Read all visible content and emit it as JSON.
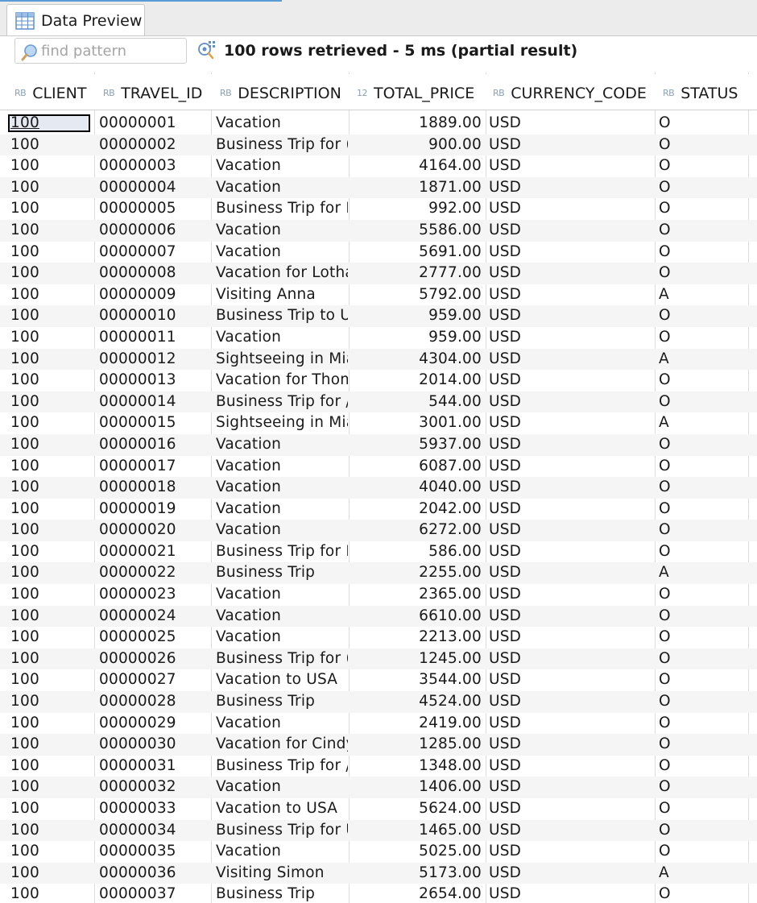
{
  "tab": {
    "label": "Data Preview"
  },
  "toolbar": {
    "search_placeholder": "find pattern",
    "status": "100 rows retrieved - 5 ms (partial result)"
  },
  "columns": [
    {
      "type": "RB",
      "name": "CLIENT"
    },
    {
      "type": "RB",
      "name": "TRAVEL_ID"
    },
    {
      "type": "RB",
      "name": "DESCRIPTION"
    },
    {
      "type": "12",
      "name": "TOTAL_PRICE"
    },
    {
      "type": "RB",
      "name": "CURRENCY_CODE"
    },
    {
      "type": "RB",
      "name": "STATUS"
    }
  ],
  "rows": [
    [
      "100",
      "00000001",
      "Vacation",
      "1889.00",
      "USD",
      "O"
    ],
    [
      "100",
      "00000002",
      "Business Trip for (",
      "900.00",
      "USD",
      "O"
    ],
    [
      "100",
      "00000003",
      "Vacation",
      "4164.00",
      "USD",
      "O"
    ],
    [
      "100",
      "00000004",
      "Vacation",
      "1871.00",
      "USD",
      "O"
    ],
    [
      "100",
      "00000005",
      "Business Trip for I",
      "992.00",
      "USD",
      "O"
    ],
    [
      "100",
      "00000006",
      "Vacation",
      "5586.00",
      "USD",
      "O"
    ],
    [
      "100",
      "00000007",
      "Vacation",
      "5691.00",
      "USD",
      "O"
    ],
    [
      "100",
      "00000008",
      "Vacation for Lotha",
      "2777.00",
      "USD",
      "O"
    ],
    [
      "100",
      "00000009",
      "Visiting Anna",
      "5792.00",
      "USD",
      "A"
    ],
    [
      "100",
      "00000010",
      "Business Trip to U",
      "959.00",
      "USD",
      "O"
    ],
    [
      "100",
      "00000011",
      "Vacation",
      "959.00",
      "USD",
      "O"
    ],
    [
      "100",
      "00000012",
      "Sightseeing in Mia",
      "4304.00",
      "USD",
      "A"
    ],
    [
      "100",
      "00000013",
      "Vacation for Thom",
      "2014.00",
      "USD",
      "O"
    ],
    [
      "100",
      "00000014",
      "Business Trip for /",
      "544.00",
      "USD",
      "O"
    ],
    [
      "100",
      "00000015",
      "Sightseeing in Mia",
      "3001.00",
      "USD",
      "A"
    ],
    [
      "100",
      "00000016",
      "Vacation",
      "5937.00",
      "USD",
      "O"
    ],
    [
      "100",
      "00000017",
      "Vacation",
      "6087.00",
      "USD",
      "O"
    ],
    [
      "100",
      "00000018",
      "Vacation",
      "4040.00",
      "USD",
      "O"
    ],
    [
      "100",
      "00000019",
      "Vacation",
      "2042.00",
      "USD",
      "O"
    ],
    [
      "100",
      "00000020",
      "Vacation",
      "6272.00",
      "USD",
      "O"
    ],
    [
      "100",
      "00000021",
      "Business Trip for I",
      "586.00",
      "USD",
      "O"
    ],
    [
      "100",
      "00000022",
      "Business Trip",
      "2255.00",
      "USD",
      "A"
    ],
    [
      "100",
      "00000023",
      "Vacation",
      "2365.00",
      "USD",
      "O"
    ],
    [
      "100",
      "00000024",
      "Vacation",
      "6610.00",
      "USD",
      "O"
    ],
    [
      "100",
      "00000025",
      "Vacation",
      "2213.00",
      "USD",
      "O"
    ],
    [
      "100",
      "00000026",
      "Business Trip for (",
      "1245.00",
      "USD",
      "O"
    ],
    [
      "100",
      "00000027",
      "Vacation to USA",
      "3544.00",
      "USD",
      "O"
    ],
    [
      "100",
      "00000028",
      "Business Trip",
      "4524.00",
      "USD",
      "O"
    ],
    [
      "100",
      "00000029",
      "Vacation",
      "2419.00",
      "USD",
      "O"
    ],
    [
      "100",
      "00000030",
      "Vacation for Cindy",
      "1285.00",
      "USD",
      "O"
    ],
    [
      "100",
      "00000031",
      "Business Trip for /",
      "1348.00",
      "USD",
      "O"
    ],
    [
      "100",
      "00000032",
      "Vacation",
      "1406.00",
      "USD",
      "O"
    ],
    [
      "100",
      "00000033",
      "Vacation to USA",
      "5624.00",
      "USD",
      "O"
    ],
    [
      "100",
      "00000034",
      "Business Trip for U",
      "1465.00",
      "USD",
      "O"
    ],
    [
      "100",
      "00000035",
      "Vacation",
      "5025.00",
      "USD",
      "O"
    ],
    [
      "100",
      "00000036",
      "Visiting Simon",
      "5173.00",
      "USD",
      "A"
    ],
    [
      "100",
      "00000037",
      "Business Trip",
      "2654.00",
      "USD",
      "O"
    ]
  ],
  "selected_cell": {
    "row": 0,
    "col": 0
  }
}
